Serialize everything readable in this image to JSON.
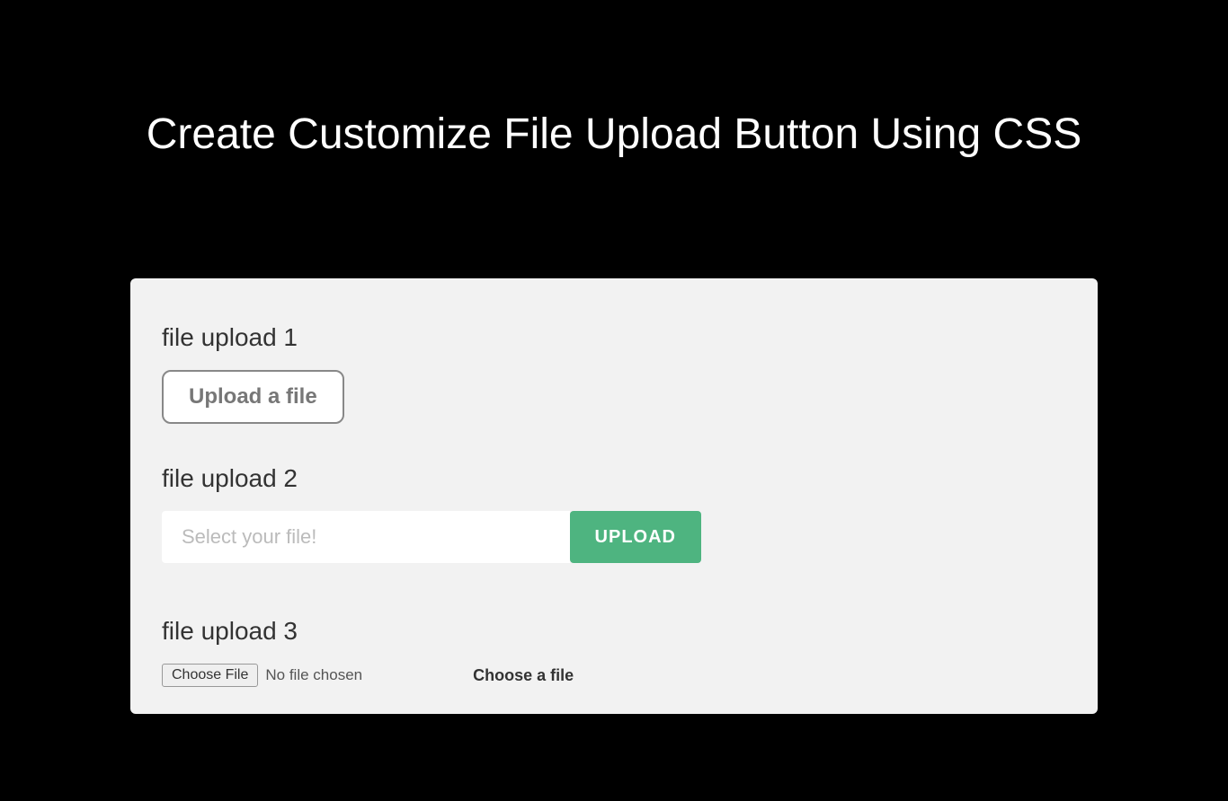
{
  "page": {
    "title": "Create Customize File Upload Button Using CSS"
  },
  "section1": {
    "heading": "file upload 1",
    "button_label": "Upload a file"
  },
  "section2": {
    "heading": "file upload 2",
    "placeholder": "Select your file!",
    "button_label": "UPLOAD"
  },
  "section3": {
    "heading": "file upload 3",
    "native_button_label": "Choose File",
    "native_status": "No file chosen",
    "bold_label": "Choose a file"
  }
}
